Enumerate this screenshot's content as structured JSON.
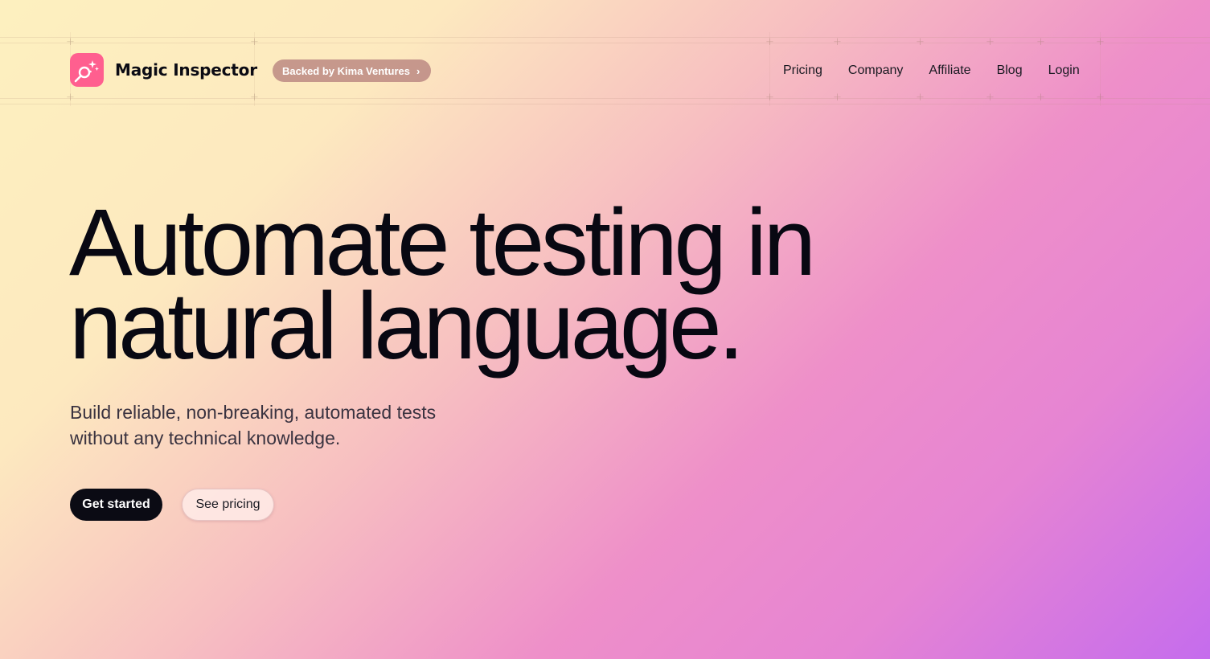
{
  "header": {
    "brand_name": "Magic Inspector",
    "logo_icon": "magnifier-sparkles-icon",
    "backed_pill": "Backed by Kima Ventures",
    "backed_chevron": "›",
    "nav": [
      {
        "label": "Pricing"
      },
      {
        "label": "Company"
      },
      {
        "label": "Affiliate"
      },
      {
        "label": "Blog"
      },
      {
        "label": "Login"
      }
    ]
  },
  "hero": {
    "title_line1": "Automate testing in",
    "title_line2": "natural language.",
    "subtitle_line1": "Build reliable, non-breaking, automated tests",
    "subtitle_line2": "without any technical knowledge.",
    "primary_button": "Get started",
    "secondary_button": "See pricing"
  },
  "colors": {
    "brand_pink": "#ff5f8f",
    "primary_button_bg": "#0b0b14",
    "gradient_start": "#fdf0bf",
    "gradient_end": "#c56ced"
  }
}
